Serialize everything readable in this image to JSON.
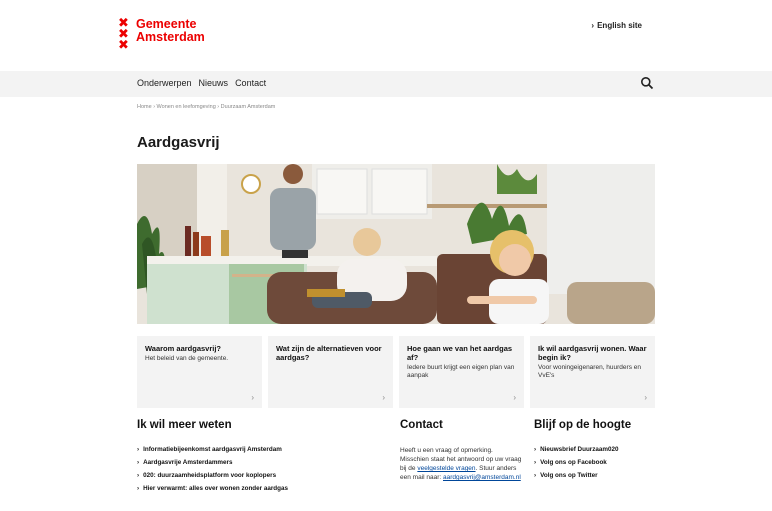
{
  "header": {
    "logo_crosses": [
      "✖",
      "✖",
      "✖"
    ],
    "logo_line1": "Gemeente",
    "logo_line2": "Amsterdam",
    "english_link": "English site",
    "chevron": "›"
  },
  "nav": {
    "items": [
      "Onderwerpen",
      "Nieuws",
      "Contact"
    ]
  },
  "breadcrumb": "Home › Wonen en leefomgeving › Duurzaam Amsterdam",
  "page_title": "Aardgasvrij",
  "cards": [
    {
      "title": "Waarom aardgasvrij?",
      "desc": "Het beleid van de gemeente."
    },
    {
      "title": "Wat zijn de alternatieven voor aardgas?",
      "desc": ""
    },
    {
      "title": "Hoe gaan we van het aardgas af?",
      "desc": "Iedere buurt krijgt een eigen plan van aanpak"
    },
    {
      "title": "Ik wil aardgasvrij wonen. Waar begin ik?",
      "desc": "Voor woningeigenaren, huurders en VvE's"
    }
  ],
  "meer_weten": {
    "title": "Ik wil meer weten",
    "links": [
      "Informatiebijeenkomst aardgasvrij Amsterdam",
      "Aardgasvrije Amsterdammers",
      "020: duurzaamheidsplatform voor koplopers",
      "Hier verwarmt: alles over wonen zonder aardgas"
    ]
  },
  "contact": {
    "title": "Contact",
    "text": "Heeft u een vraag of opmerking. Misschien staat het antwoord op uw vraag bij de ",
    "link1": "veelgestelde vragen",
    "text2": ". Stuur anders een mail naar: ",
    "link2": "aardgasvrij@amsterdam.nl"
  },
  "hoogte": {
    "title": "Blijf op de hoogte",
    "links": [
      "Nieuwsbrief Duurzaam020",
      "Volg ons op Facebook",
      "Volg ons op Twitter"
    ]
  },
  "colors": {
    "brand_red": "#ec0000",
    "nav_bg": "#f3f3f3",
    "link_blue": "#004699"
  }
}
